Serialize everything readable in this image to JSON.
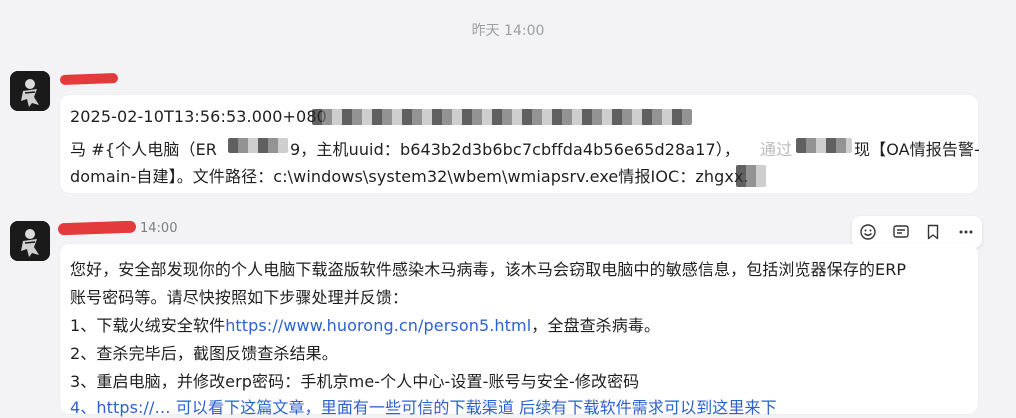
{
  "divider_time": "昨天 14:00",
  "message1": {
    "line1": "2025-02-10T13:56:53.000+080",
    "line2_prefix": "马 #{个人电脑（ER",
    "line2_middle": "9，主机uuid：b643b2d3b6bc7cbffda4b56e65d28a17），",
    "line2_tail_fragment_1": "通过",
    "line2_tail_fragment_2": "现【OA情报告警-",
    "line3": "domain-自建】。文件路径：c:\\windows\\system32\\wbem\\wmiapsrv.exe情报IOC：zhgxx."
  },
  "message2": {
    "time": "14:00",
    "lines": [
      "您好，安全部发现你的个人电脑下载盗版软件感染木马病毒，该木马会窃取电脑中的敏感信息，包括浏览器保存的ERP",
      "账号密码等。请尽快按照如下步骤处理并反馈："
    ],
    "step1_prefix": "1、下载火绒安全软件",
    "step1_link": "https://www.huorong.cn/person5.html",
    "step1_suffix": "，全盘查杀病毒。",
    "step2": "2、查杀完毕后，截图反馈查杀结果。",
    "step3": "3、重启电脑，并修改erp密码：手机京me-个人中心-设置-账号与安全-修改密码",
    "step4_partial": "4、https://… 可以看下这篇文章，里面有一些可信的下载渠道 后续有下载软件需求可以到这里来下"
  },
  "action_bar_icons": [
    "emoji-icon",
    "quote-icon",
    "bookmark-icon",
    "more-icon"
  ],
  "colors": {
    "background": "#f3f3f5",
    "bubble": "#ffffff",
    "link": "#2b61d1",
    "redaction": "#e33b3b",
    "meta_text": "#9aa0a6"
  }
}
